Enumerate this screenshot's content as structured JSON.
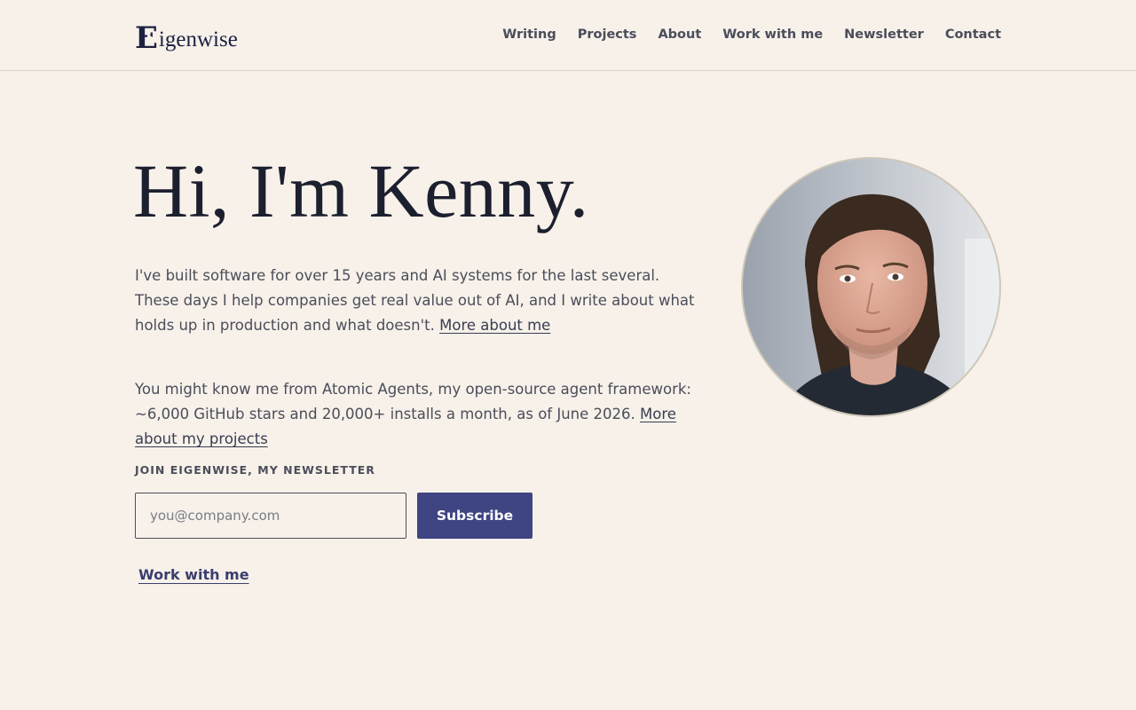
{
  "header": {
    "logo_mark": "E",
    "logo_text": "igenwise",
    "nav": [
      "Writing",
      "Projects",
      "About",
      "Work with me",
      "Newsletter",
      "Contact"
    ]
  },
  "hero": {
    "title": "Hi, I'm Kenny.",
    "para1_text": "I've built software for over 15 years and AI systems for the last several. These days I help companies get real value out of AI, and I write about what holds up in production and what doesn't.",
    "para1_link": "More about me",
    "para2_text": "You might know me from Atomic Agents, my open-source agent framework: ~6,000 GitHub stars and 20,000+ installs a month, as of June 2026.",
    "para2_link": "More about my projects"
  },
  "newsletter": {
    "label": "JOIN EIGENWISE, MY NEWSLETTER",
    "email_placeholder": "you@company.com",
    "email_value": "",
    "subscribe_label": "Subscribe"
  },
  "work_link": "Work with me",
  "colors": {
    "background": "#f7f1ea",
    "text": "#1c1f2e",
    "accent": "#3f4482"
  }
}
